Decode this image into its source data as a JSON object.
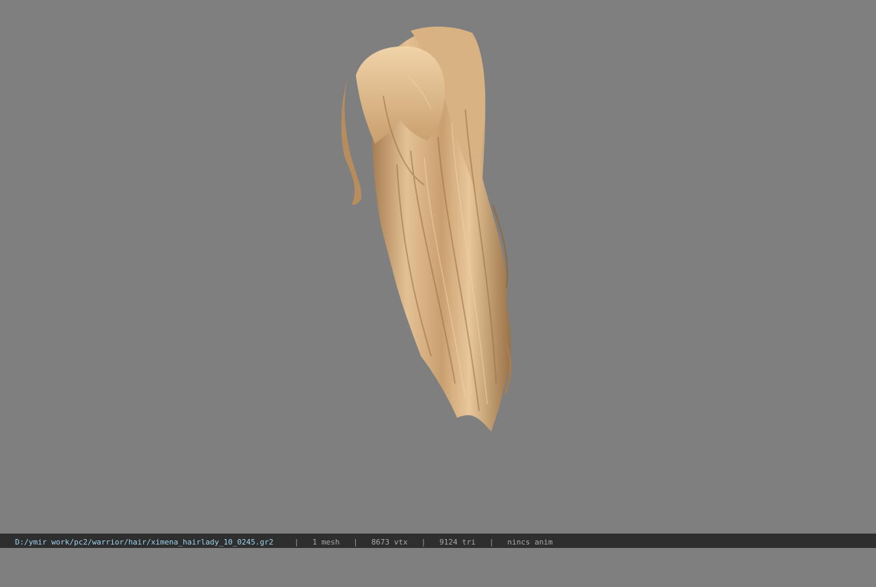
{
  "viewport": {
    "background": "#7f7f7f",
    "model": "ximena_hairlady_10_0245 hair mesh"
  },
  "statusbar": {
    "path": "D:/ymir work/pc2/warrior/hair/ximena_hairlady_10_0245.gr2",
    "mesh": "1 mesh",
    "vtx": "8673 vtx",
    "tri": "9124 tri",
    "anim": "nincs anim",
    "separator": "|"
  },
  "colors": {
    "hair_light": "#e6c496",
    "hair_mid": "#c9a070",
    "hair_dark": "#8f6a44",
    "statusbar_bg": "#2e2e2e",
    "path_text": "#9fd3ee",
    "info_text": "#a9a9a9"
  }
}
